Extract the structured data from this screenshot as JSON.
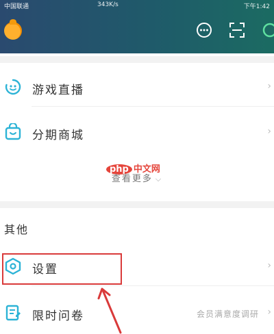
{
  "status_bar": {
    "carrier": "中国联通",
    "speed": "343K/s",
    "time": "下午1:42"
  },
  "header": {
    "avatar_icon": "orange-avatar-icon",
    "chat_icon": "chat-bubble-icon",
    "scan_icon": "scan-icon",
    "color_left": "#2a4a6f",
    "color_right": "#1b6b62"
  },
  "menu": {
    "items": [
      {
        "label": "游戏直播",
        "icon": "game-live-icon"
      },
      {
        "label": "分期商城",
        "icon": "shopping-bag-icon"
      }
    ],
    "see_more": "查看更多",
    "see_more_icon": "chevron-down-icon"
  },
  "watermark": {
    "php": "php",
    "text": "中文网"
  },
  "others": {
    "title": "其他",
    "items": [
      {
        "label": "设置",
        "icon": "settings-hexagon-icon",
        "hint": ""
      },
      {
        "label": "限时问卷",
        "icon": "questionnaire-icon",
        "hint": "会员满意度调研"
      }
    ]
  },
  "annotation": {
    "color": "#d93a3a"
  }
}
